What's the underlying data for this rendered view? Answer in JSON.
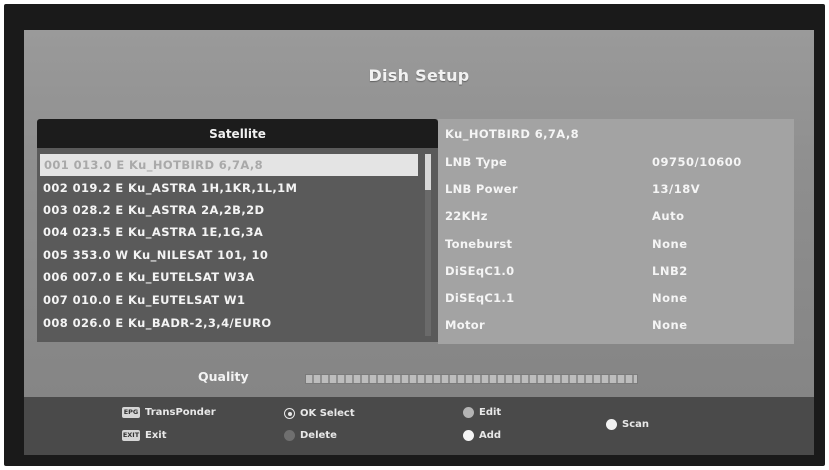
{
  "title": "Dish Setup",
  "satellite": {
    "header": "Satellite",
    "items": [
      "001 013.0 E  Ku_HOTBIRD 6,7A,8",
      "002 019.2 E  Ku_ASTRA 1H,1KR,1L,1M",
      "003 028.2 E  Ku_ASTRA 2A,2B,2D",
      "004 023.5 E  Ku_ASTRA 1E,1G,3A",
      "005 353.0 W  Ku_NILESAT 101, 10",
      "006 007.0 E  Ku_EUTELSAT W3A",
      "007 010.0 E  Ku_EUTELSAT W1",
      "008 026.0 E  Ku_BADR-2,3,4/EURO"
    ],
    "selected_index": 0
  },
  "info": {
    "title": "Ku_HOTBIRD 6,7A,8",
    "rows": [
      {
        "label": "LNB Type",
        "value": "09750/10600"
      },
      {
        "label": "LNB Power",
        "value": "13/18V"
      },
      {
        "label": "22KHz",
        "value": "Auto"
      },
      {
        "label": "Toneburst",
        "value": "None"
      },
      {
        "label": "DiSEqC1.0",
        "value": "LNB2"
      },
      {
        "label": "DiSEqC1.1",
        "value": "None"
      },
      {
        "label": "Motor",
        "value": "None"
      }
    ]
  },
  "quality": {
    "label": "Quality"
  },
  "footer": {
    "transponder": {
      "key": "EPG",
      "label": "TransPonder"
    },
    "exit": {
      "key": "EXIT",
      "label": "Exit"
    },
    "ok_select": {
      "label": "OK Select"
    },
    "delete": {
      "label": "Delete"
    },
    "edit": {
      "label": "Edit"
    },
    "add": {
      "label": "Add"
    },
    "scan": {
      "label": "Scan"
    }
  },
  "colors": {
    "red_key": "#9a9a9a",
    "green_key": "#6f6f6f",
    "yellow_key": "#b4b4b4",
    "blue_key": "#f2f2f2",
    "white_key": "#f4f4f4"
  }
}
